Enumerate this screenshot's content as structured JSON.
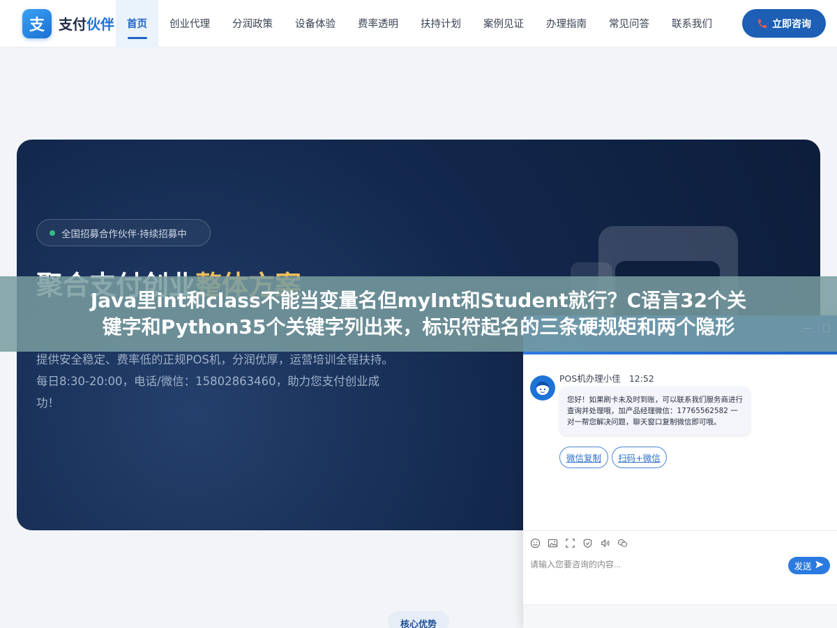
{
  "header": {
    "logo_mark": "支",
    "logo_text_main": "支付",
    "logo_text_accent": "伙伴",
    "nav": [
      {
        "label": "首页",
        "active": true
      },
      {
        "label": "创业代理"
      },
      {
        "label": "分润政策"
      },
      {
        "label": "设备体验"
      },
      {
        "label": "费率透明"
      },
      {
        "label": "扶持计划"
      },
      {
        "label": "案例见证"
      },
      {
        "label": "办理指南"
      },
      {
        "label": "常见问答"
      },
      {
        "label": "联系我们"
      }
    ],
    "consult_label": "立即咨询"
  },
  "hero": {
    "badge": "全国招募合作伙伴·持续招募中",
    "title_main": "聚合支付创业",
    "title_accent": "整体方案",
    "description": "提供安全稳定、费率低的正规POS机，分润优厚，运营培训全程扶持。每日8:30-20:00，电话/微信：15802863460，助力您支付创业成功！"
  },
  "banner": {
    "line1": "Java里int和class不能当变量名但myInt和Student就行？C语言32个关",
    "line2": "键字和Python35个关键字列出来，标识符起名的三条硬规矩和两个隐形"
  },
  "chat": {
    "agent_name": "POS机办理小佳",
    "time": "12:52",
    "message": "您好！如果刷卡未及时到账，可以联系我们服务商进行查询并处理哦，加产品经理微信：17765562582 一对一帮您解决问题，聊天窗口复制微信即可哦。",
    "chip_copy_wechat": "微信复制",
    "chip_scan_wechat": "扫码+微信",
    "input_placeholder": "请输入您要咨询的内容...",
    "send_label": "发送",
    "minimize_glyph": "—",
    "maximize_glyph": "□"
  },
  "section": {
    "pill": "核心优势"
  },
  "colors": {
    "brand_blue": "#1c5fb4",
    "accent_gold": "#f0c15a",
    "hero_bg": "#13284d",
    "banner_overlay": "#789ca0"
  }
}
